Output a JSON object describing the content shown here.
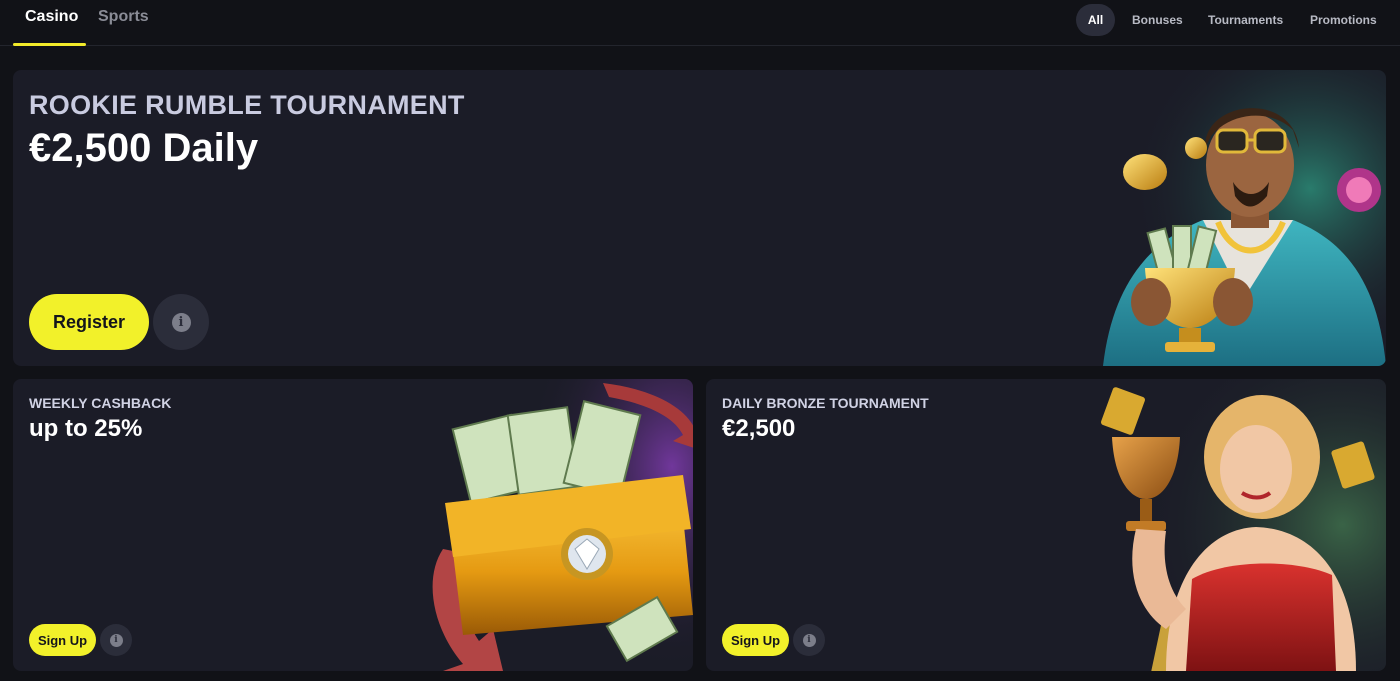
{
  "header": {
    "main_tabs": [
      {
        "label": "Casino",
        "active": true
      },
      {
        "label": "Sports",
        "active": false
      }
    ],
    "filters": [
      {
        "label": "All",
        "active": true
      },
      {
        "label": "Bonuses",
        "active": false
      },
      {
        "label": "Tournaments",
        "active": false
      },
      {
        "label": "Promotions",
        "active": false
      }
    ]
  },
  "hero": {
    "kicker": "ROOKIE RUMBLE TOURNAMENT",
    "headline": "€2,500 Daily",
    "button_label": "Register",
    "info_glyph": "i",
    "art_icon": "casino-man-with-trophy-illustration"
  },
  "cards": [
    {
      "kicker": "WEEKLY CASHBACK",
      "headline": "up to 25%",
      "button_label": "Sign Up",
      "info_glyph": "i",
      "art_icon": "golden-wallet-with-cash-illustration"
    },
    {
      "kicker": "DAILY BRONZE TOURNAMENT",
      "headline": "€2,500",
      "button_label": "Sign Up",
      "info_glyph": "i",
      "art_icon": "woman-holding-trophy-illustration"
    }
  ],
  "colors": {
    "background": "#111217",
    "card": "#1b1c27",
    "accent_yellow": "#f2f12a",
    "tab_underline": "#f2ea2a",
    "info_button": "#2b2d3a"
  }
}
